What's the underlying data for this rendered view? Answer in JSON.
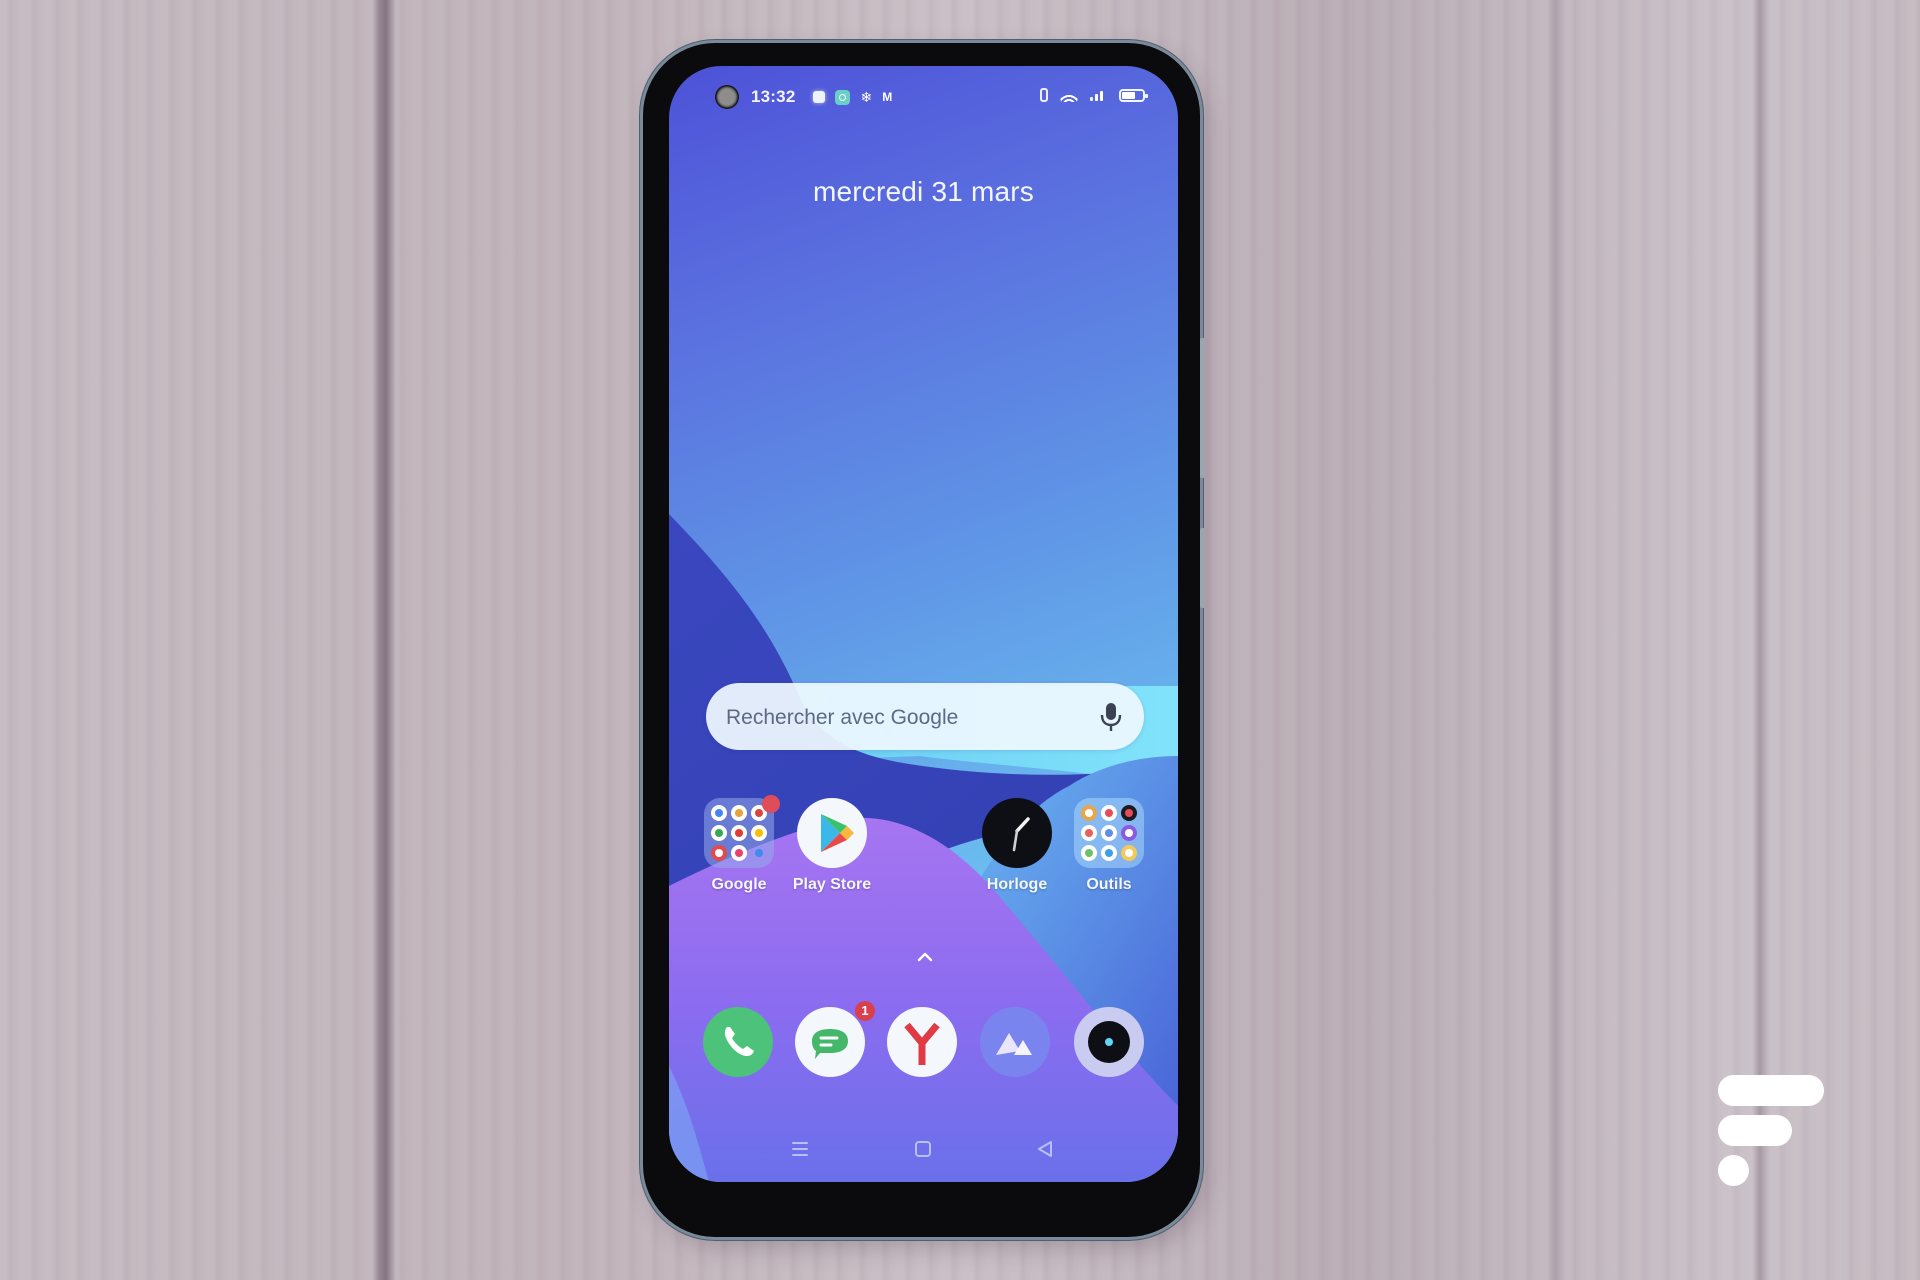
{
  "status_bar": {
    "time": "13:32",
    "notification_icons": [
      "app-notification-icon",
      "vpn-icon",
      "snowflake-icon",
      "gmail-icon"
    ],
    "system_icons": [
      "vibrate-icon",
      "wifi-icon",
      "signal-icon",
      "battery-icon"
    ],
    "battery_level_fraction": 0.6
  },
  "home": {
    "date": "mercredi 31 mars",
    "search": {
      "placeholder": "Rechercher avec Google",
      "value": ""
    },
    "apps": [
      {
        "label": "Google",
        "type": "folder",
        "has_badge": true
      },
      {
        "label": "Play Store",
        "type": "app"
      },
      {
        "label": "Horloge",
        "type": "app"
      },
      {
        "label": "Outils",
        "type": "folder"
      }
    ],
    "dock": [
      {
        "name": "Téléphone",
        "icon": "phone-icon"
      },
      {
        "name": "Messages",
        "icon": "messages-icon",
        "badge": "1"
      },
      {
        "name": "Yandex",
        "icon": "yandex-browser-icon"
      },
      {
        "name": "Photos",
        "icon": "gallery-icon"
      },
      {
        "name": "Appareil photo",
        "icon": "camera-icon"
      }
    ],
    "app_drawer_hint": "chevron-up-icon"
  },
  "nav_bar": [
    "menu-button",
    "home-button",
    "back-button"
  ],
  "colors": {
    "wallpaper_top_left": "#4d52d8",
    "wallpaper_top_right": "#7ad7f8",
    "wallpaper_purple": "#9b6cf0",
    "wallpaper_navy": "#3443b8",
    "badge_red": "#d9404d",
    "phone_green": "#4cc27a",
    "yandex_red": "#e03a45"
  },
  "watermark": "frandroid-logo"
}
